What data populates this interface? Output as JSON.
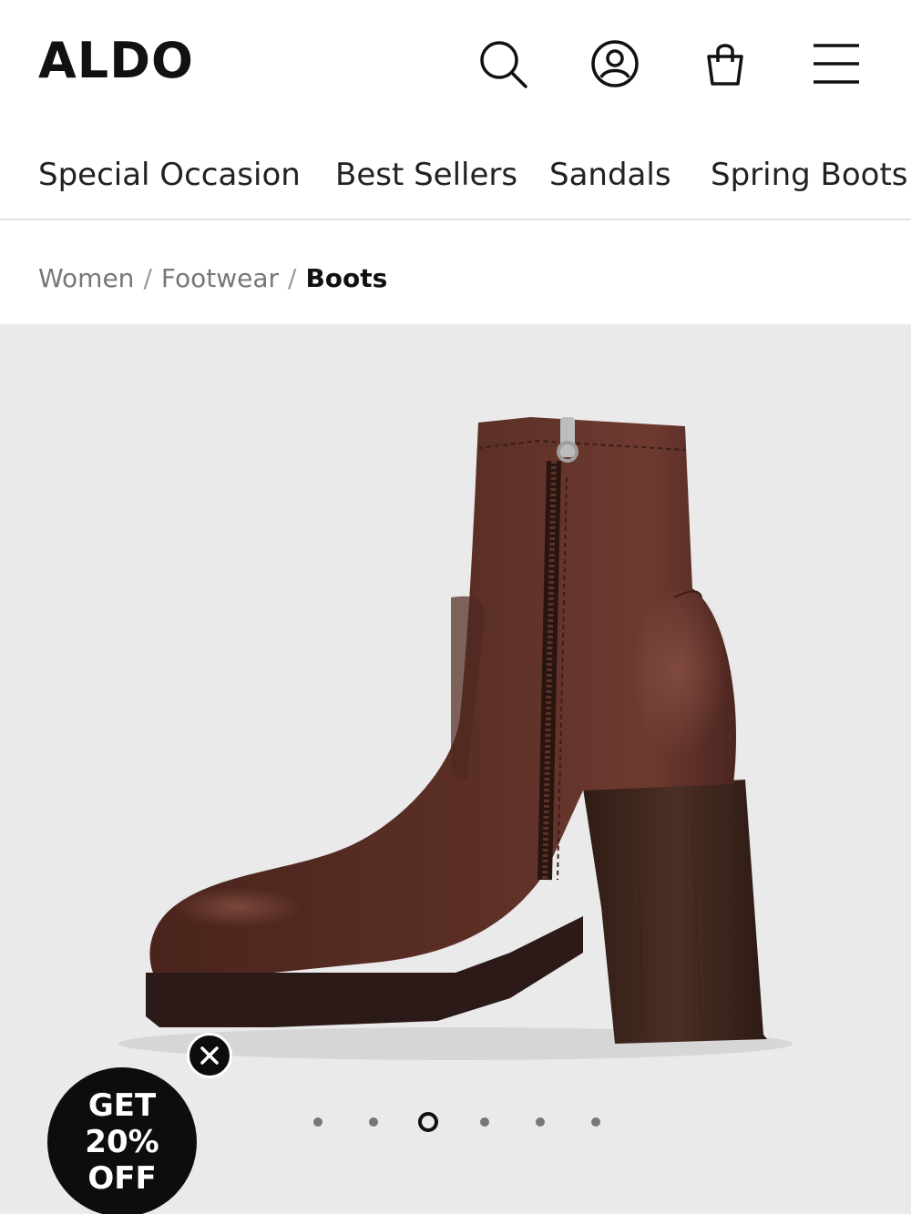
{
  "header": {
    "logo_text": "ALDO",
    "icons": [
      "search-icon",
      "account-icon",
      "shopping-bag-icon",
      "menu-icon"
    ]
  },
  "nav": {
    "items": [
      "Special Occasion",
      "Best Sellers",
      "Sandals",
      "Spring Boots"
    ]
  },
  "breadcrumb": {
    "items": [
      "Women",
      "Footwear",
      "Boots"
    ],
    "separator": "/"
  },
  "gallery": {
    "image": "brown-leather-platform-ankle-boot",
    "total_slides": 6,
    "active_slide": 3,
    "background_color": "#eaeaea"
  },
  "promo": {
    "lines": [
      "GET",
      "20%",
      "OFF"
    ],
    "close_icon": "close-icon",
    "background_color": "#0d0d0d"
  }
}
